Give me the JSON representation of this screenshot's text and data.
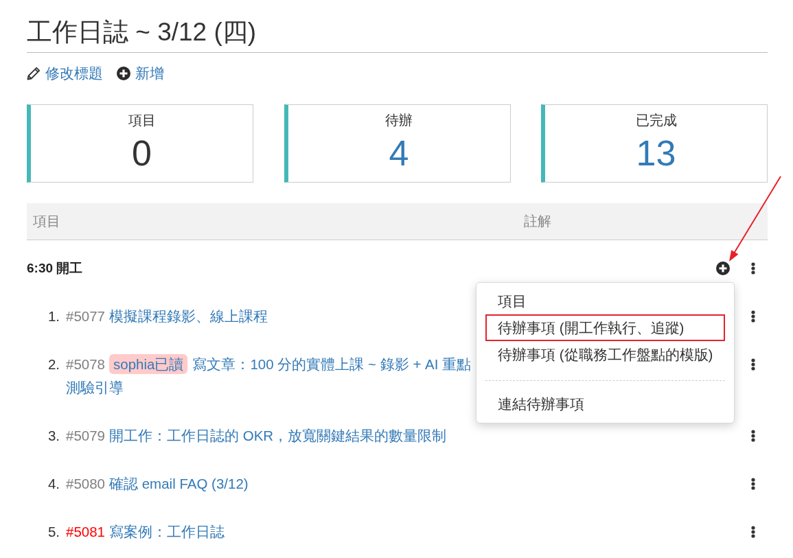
{
  "page_title": "工作日誌 ~ 3/12 (四)",
  "actions": [
    {
      "kind": "edit",
      "label": "修改標題"
    },
    {
      "kind": "add",
      "label": "新增"
    }
  ],
  "stats": [
    {
      "label": "項目",
      "value": "0",
      "color": "#333333"
    },
    {
      "label": "待辦",
      "value": "4",
      "color": "#337ab7"
    },
    {
      "label": "已完成",
      "value": "13",
      "color": "#337ab7"
    }
  ],
  "table": {
    "columns": [
      "項目",
      "註解"
    ]
  },
  "groups": [
    {
      "title": "6:30 開工",
      "add_menu": {
        "open": true,
        "sections": [
          {
            "items": [
              {
                "label": "項目",
                "highlighted": false
              },
              {
                "label": "待辦事項 (開工作執行、追蹤)",
                "highlighted": true
              },
              {
                "label": "待辦事項 (從職務工作盤點的模版)",
                "highlighted": false
              }
            ]
          },
          {
            "items": [
              {
                "label": "連結待辦事項",
                "highlighted": false
              }
            ]
          }
        ]
      },
      "items": [
        {
          "number": "1.",
          "ref": {
            "text": "#5077",
            "color": "#808080"
          },
          "title_lines": [
            "模擬課程錄影、線上課程"
          ]
        },
        {
          "number": "2.",
          "ref": {
            "text": "#5078",
            "color": "#808080"
          },
          "tags": [
            "sophia已讀"
          ],
          "title_lines": [
            "寫文章：100 分的實體上課 ~ 錄影 + AI 重點",
            "測驗引導"
          ]
        },
        {
          "number": "3.",
          "ref": {
            "text": "#5079",
            "color": "#808080"
          },
          "title_lines": [
            "開工作：工作日誌的 OKR，放寬關鍵結果的數量限制"
          ]
        },
        {
          "number": "4.",
          "ref": {
            "text": "#5080",
            "color": "#808080"
          },
          "title_lines": [
            "確認 email FAQ (3/12)"
          ]
        },
        {
          "number": "5.",
          "ref": {
            "text": "#5081",
            "color": "#ff0000"
          },
          "title_lines": [
            "寫案例：工作日誌"
          ]
        }
      ]
    }
  ]
}
